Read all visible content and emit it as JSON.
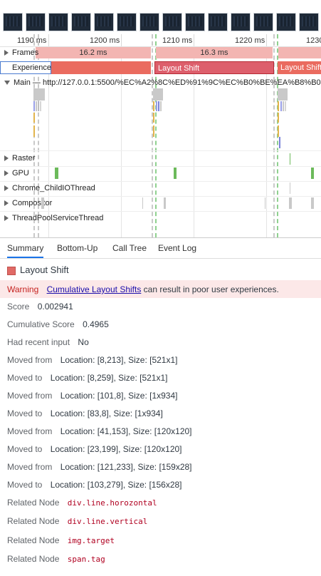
{
  "ruler": {
    "labels": [
      "1190 ms",
      "1200 ms",
      "1210 ms",
      "1220 ms",
      "1230"
    ]
  },
  "tracks": {
    "frames_label": "Frames",
    "frame_durations": [
      "16.2 ms",
      "16.3 ms"
    ],
    "experience_label": "Experience",
    "layout_shift_labels": [
      "Layout Shift",
      "Layout Shift",
      "Layout Shift"
    ],
    "main_label": "Main — http://127.0.0.1:5500/%EC%A2%8C%ED%91%9C%EC%B0%BE%EA%B8%B0%EC%",
    "raster_label": "Raster",
    "gpu_label": "GPU",
    "childio_label": "Chrome_ChildIOThread",
    "compositor_label": "Compositor",
    "threadpool_label": "ThreadPoolServiceThread"
  },
  "tabs": [
    "Summary",
    "Bottom-Up",
    "Call Tree",
    "Event Log"
  ],
  "summary": {
    "title": "Layout Shift",
    "warning_label": "Warning",
    "warning_link": "Cumulative Layout Shifts",
    "warning_text": "can result in poor user experiences.",
    "score_key": "Score",
    "score_value": "0.002941",
    "cumulative_key": "Cumulative Score",
    "cumulative_value": "0.4965",
    "recent_input_key": "Had recent input",
    "recent_input_value": "No",
    "moves": [
      {
        "key": "Moved from",
        "value": "Location: [8,213], Size: [521x1]"
      },
      {
        "key": "Moved to",
        "value": "Location: [8,259], Size: [521x1]"
      },
      {
        "key": "Moved from",
        "value": "Location: [101,8], Size: [1x934]"
      },
      {
        "key": "Moved to",
        "value": "Location: [83,8], Size: [1x934]"
      },
      {
        "key": "Moved from",
        "value": "Location: [41,153], Size: [120x120]"
      },
      {
        "key": "Moved to",
        "value": "Location: [23,199], Size: [120x120]"
      },
      {
        "key": "Moved from",
        "value": "Location: [121,233], Size: [159x28]"
      },
      {
        "key": "Moved to",
        "value": "Location: [103,279], Size: [156x28]"
      }
    ],
    "nodes_key": "Related Node",
    "nodes": [
      "div.line.horozontal",
      "div.line.vertical",
      "img.target",
      "span.tag"
    ]
  },
  "colors": {
    "layout_shift": "#ea6b5f",
    "layout_shift_selected": "#dd5f6c",
    "frame": "#f3b5b2",
    "gpu": "#6cba5b",
    "warning_bg": "#fce8e8",
    "accent": "#1a73e8"
  }
}
